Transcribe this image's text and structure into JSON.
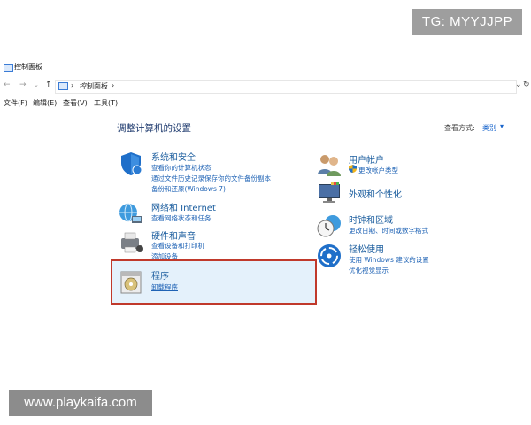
{
  "watermarks": {
    "top_right": "TG: MYYJJPP",
    "bottom_left": "www.playkaifa.com"
  },
  "window": {
    "title": "控制面板",
    "icon": "control-panel-icon"
  },
  "address": {
    "path_label": "控制面板",
    "separator": "›"
  },
  "menu": {
    "file": "文件(F)",
    "edit": "编辑(E)",
    "view": "查看(V)",
    "tools": "工具(T)"
  },
  "page": {
    "title": "调整计算机的设置",
    "view_by_label": "查看方式:",
    "view_by_value": "类别"
  },
  "left_categories": [
    {
      "title": "系统和安全",
      "icon": "shield-flag-icon",
      "links": [
        "查看你的计算机状态",
        "通过文件历史记录保存你的文件备份副本",
        "备份和还原(Windows 7)"
      ]
    },
    {
      "title": "网络和 Internet",
      "icon": "network-globe-icon",
      "links": [
        "查看网络状态和任务"
      ]
    },
    {
      "title": "硬件和声音",
      "icon": "printer-speaker-icon",
      "links": [
        "查看设备和打印机",
        "添加设备"
      ]
    },
    {
      "title": "程序",
      "icon": "programs-disc-icon",
      "links": [
        "卸载程序"
      ]
    }
  ],
  "right_categories": [
    {
      "title": "用户帐户",
      "icon": "users-icon",
      "links": [
        "更改帐户类型"
      ]
    },
    {
      "title": "外观和个性化",
      "icon": "monitor-palette-icon",
      "links": []
    },
    {
      "title": "时钟和区域",
      "icon": "clock-globe-icon",
      "links": [
        "更改日期、时间或数字格式"
      ]
    },
    {
      "title": "轻松使用",
      "icon": "ease-of-access-icon",
      "links": [
        "使用 Windows 建议的设置",
        "优化视觉显示"
      ]
    }
  ],
  "colors": {
    "link": "#1f63b5",
    "title": "#1b5d9e",
    "highlight_border": "#c0392b",
    "highlight_bg": "#e4f1fb"
  }
}
